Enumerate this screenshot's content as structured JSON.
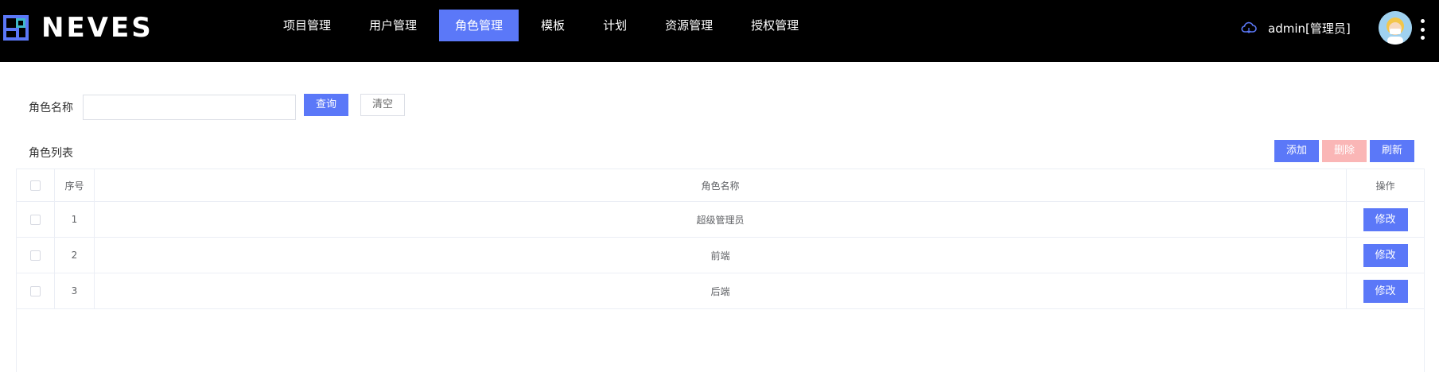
{
  "app": {
    "logo_text": "NEVES"
  },
  "nav": {
    "items": [
      {
        "label": "项目管理"
      },
      {
        "label": "用户管理"
      },
      {
        "label": "角色管理",
        "active": true
      },
      {
        "label": "模板"
      },
      {
        "label": "计划"
      },
      {
        "label": "资源管理"
      },
      {
        "label": "授权管理"
      }
    ]
  },
  "header": {
    "user_label": "admin[管理员]",
    "cloud_icon": "cloud-icon",
    "accent_color": "#5b78f8"
  },
  "search": {
    "label": "角色名称",
    "input_value": "",
    "query_label": "查询",
    "clear_label": "清空"
  },
  "list": {
    "title": "角色列表",
    "add_label": "添加",
    "delete_label": "删除",
    "refresh_label": "刷新"
  },
  "table": {
    "columns": {
      "index": "序号",
      "name": "角色名称",
      "action": "操作"
    },
    "rows": [
      {
        "index": "1",
        "name": "超级管理员",
        "action": "修改"
      },
      {
        "index": "2",
        "name": "前端",
        "action": "修改"
      },
      {
        "index": "3",
        "name": "后端",
        "action": "修改"
      }
    ]
  },
  "colors": {
    "primary": "#5b78f8",
    "danger_disabled": "#fab6b6",
    "topbar": "#000000"
  }
}
